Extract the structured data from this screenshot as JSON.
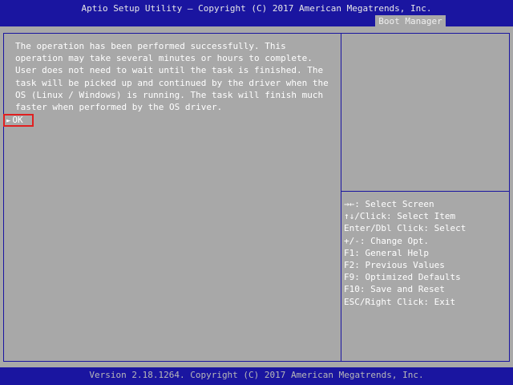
{
  "header": {
    "title": "Aptio Setup Utility – Copyright (C) 2017 American Megatrends, Inc.",
    "active_tab": "Boot Manager"
  },
  "message": {
    "lines": [
      "The operation has been performed successfully. This",
      "operation may take several minutes or hours to complete.",
      "User does not need to wait until the task is finished. The",
      "task will be picked up and continued by the driver when the",
      "OS (Linux / Windows) is running. The task will finish much",
      "faster when performed by the OS driver."
    ]
  },
  "options": {
    "ok_label": "OK",
    "ok_arrow": "►"
  },
  "help": [
    "→←: Select Screen",
    "↑↓/Click: Select Item",
    "Enter/Dbl Click: Select",
    "+/-: Change Opt.",
    "F1: General Help",
    "F2: Previous Values",
    "F9: Optimized Defaults",
    "F10: Save and Reset",
    "ESC/Right Click: Exit"
  ],
  "footer": {
    "text": "Version 2.18.1264. Copyright (C) 2017 American Megatrends, Inc."
  },
  "colors": {
    "background": "#a8a8a8",
    "bar_blue": "#1a15a0",
    "highlight_red": "#e02020"
  }
}
